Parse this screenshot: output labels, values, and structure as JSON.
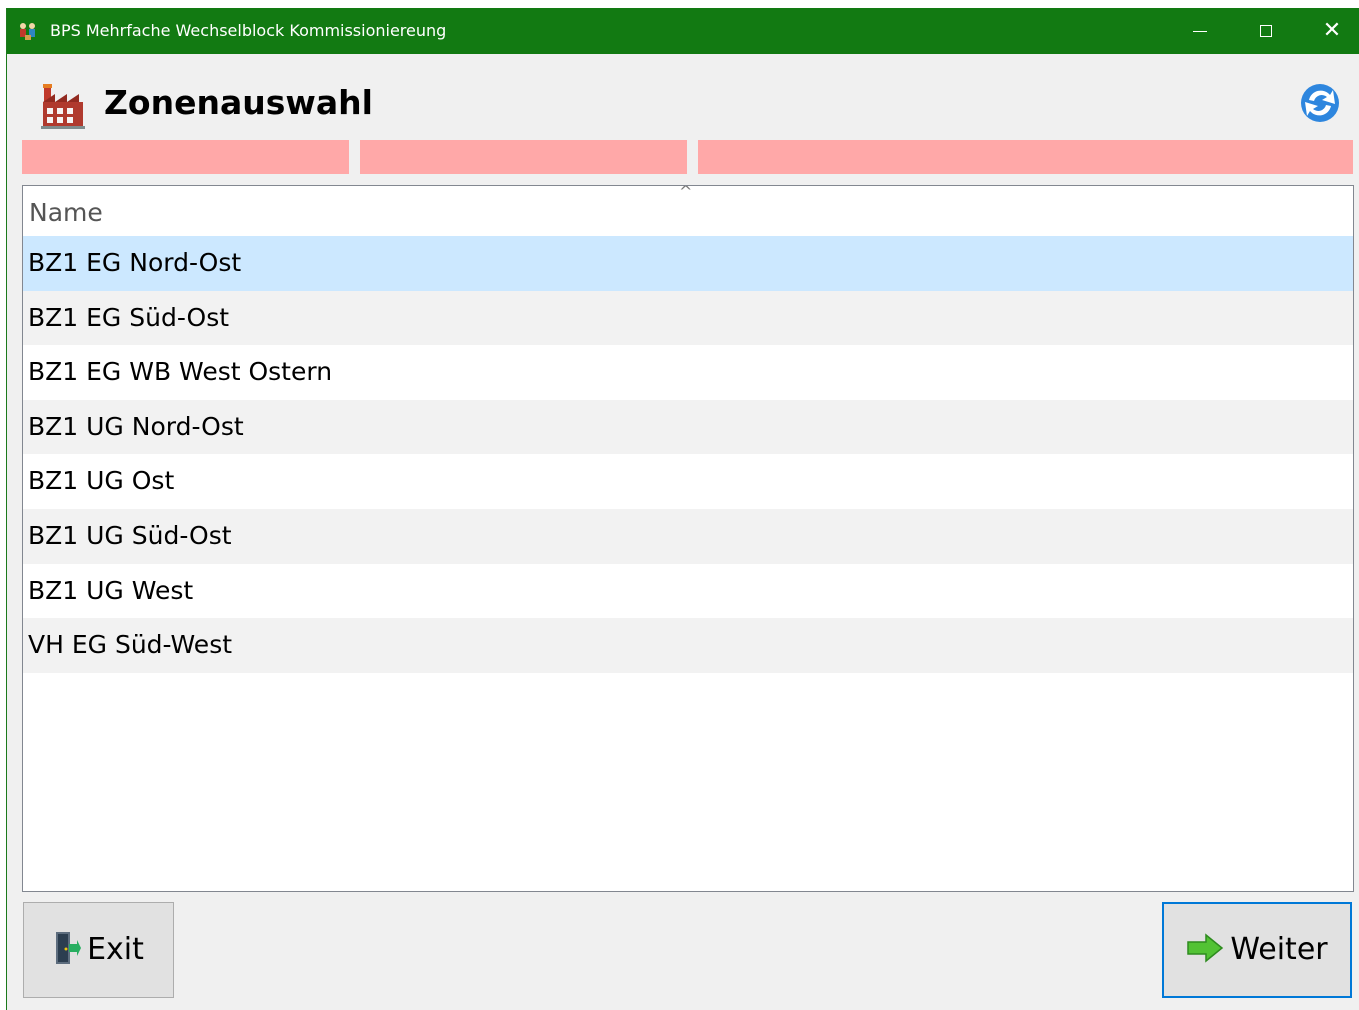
{
  "window": {
    "title": "BPS Mehrfache Wechselblock Kommissioniereung",
    "title_color": "#127a12",
    "controls": {
      "minimize": "minimize-icon",
      "maximize": "maximize-icon",
      "close": "✕"
    }
  },
  "header": {
    "title": "Zonenauswahl",
    "icon": "factory-icon",
    "refresh_icon": "refresh-icon"
  },
  "status_bar": {
    "color": "#ffa8a8",
    "segments": [
      "",
      "",
      ""
    ]
  },
  "list": {
    "column_header": "Name",
    "sort_indicator": "^",
    "selected_index": 0,
    "rows": [
      "BZ1 EG Nord-Ost",
      "BZ1 EG Süd-Ost",
      "BZ1 EG WB West Ostern",
      "BZ1 UG Nord-Ost",
      "BZ1 UG Ost",
      "BZ1 UG Süd-Ost",
      "BZ1 UG West",
      "VH EG Süd-West"
    ]
  },
  "buttons": {
    "exit": {
      "label": "Exit",
      "icon": "exit-door-icon"
    },
    "next": {
      "label": "Weiter",
      "icon": "arrow-right-icon",
      "accent": "#0078d7"
    }
  }
}
